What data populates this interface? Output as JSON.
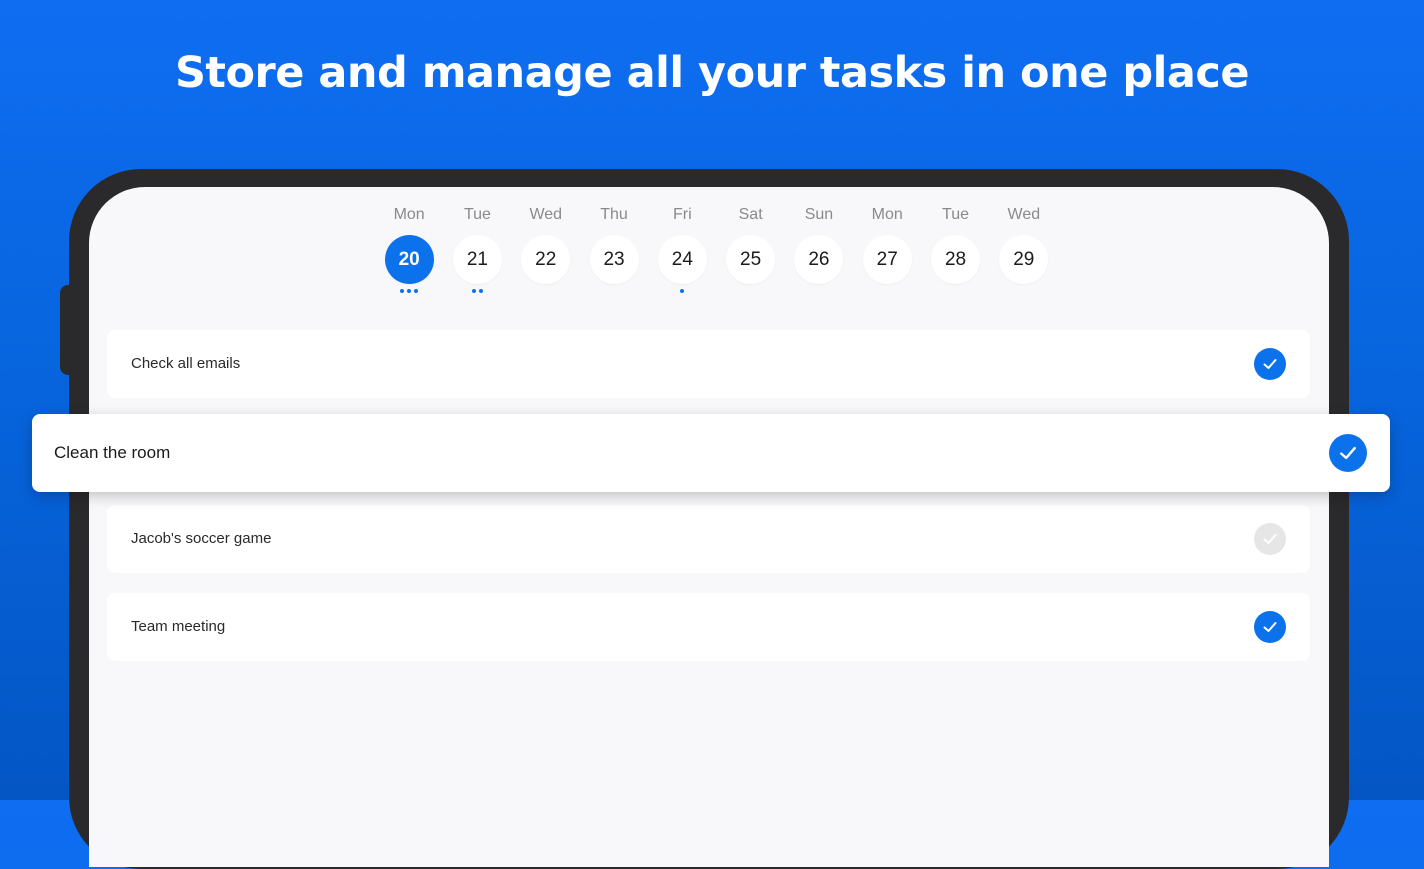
{
  "headline": "Store and manage all your tasks in one place",
  "calendar": {
    "days": [
      {
        "name": "Mon",
        "num": "20",
        "selected": true,
        "dots": 3
      },
      {
        "name": "Tue",
        "num": "21",
        "selected": false,
        "dots": 2
      },
      {
        "name": "Wed",
        "num": "22",
        "selected": false,
        "dots": 0
      },
      {
        "name": "Thu",
        "num": "23",
        "selected": false,
        "dots": 0
      },
      {
        "name": "Fri",
        "num": "24",
        "selected": false,
        "dots": 1
      },
      {
        "name": "Sat",
        "num": "25",
        "selected": false,
        "dots": 0
      },
      {
        "name": "Sun",
        "num": "26",
        "selected": false,
        "dots": 0
      },
      {
        "name": "Mon",
        "num": "27",
        "selected": false,
        "dots": 0
      },
      {
        "name": "Tue",
        "num": "28",
        "selected": false,
        "dots": 0
      },
      {
        "name": "Wed",
        "num": "29",
        "selected": false,
        "dots": 0
      }
    ]
  },
  "tasks": [
    {
      "label": "Check all emails",
      "done": true
    },
    {
      "label": "Clean the room",
      "done": true
    },
    {
      "label": "Jacob's soccer game",
      "done": false
    },
    {
      "label": "Team meeting",
      "done": true
    }
  ],
  "colors": {
    "accent": "#0c72ec",
    "background": "#0765de",
    "unchecked": "#e6e6e6"
  },
  "icons": {
    "check": "checkmark-icon"
  }
}
